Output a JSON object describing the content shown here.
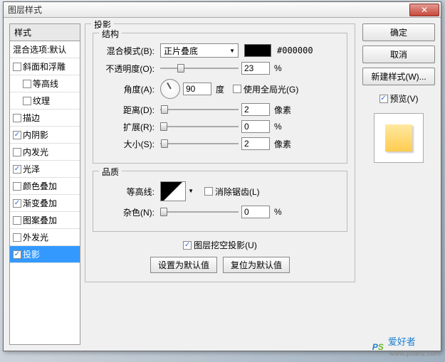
{
  "title": "图层样式",
  "close": "✕",
  "stylesHeader": "样式",
  "blendHeader": "混合选项:默认",
  "effects": [
    {
      "label": "斜面和浮雕",
      "checked": false,
      "sub": false
    },
    {
      "label": "等高线",
      "checked": false,
      "sub": true
    },
    {
      "label": "纹理",
      "checked": false,
      "sub": true
    },
    {
      "label": "描边",
      "checked": false,
      "sub": false
    },
    {
      "label": "内阴影",
      "checked": true,
      "sub": false
    },
    {
      "label": "内发光",
      "checked": false,
      "sub": false
    },
    {
      "label": "光泽",
      "checked": true,
      "sub": false
    },
    {
      "label": "颜色叠加",
      "checked": false,
      "sub": false
    },
    {
      "label": "渐变叠加",
      "checked": true,
      "sub": false
    },
    {
      "label": "图案叠加",
      "checked": false,
      "sub": false
    },
    {
      "label": "外发光",
      "checked": false,
      "sub": false
    },
    {
      "label": "投影",
      "checked": true,
      "sub": false,
      "selected": true
    }
  ],
  "center": {
    "headerGroup": "投影",
    "structGroup": "结构",
    "blendModeLabel": "混合模式(B):",
    "blendModeValue": "正片叠底",
    "hex": "#000000",
    "opacityLabel": "不透明度(O):",
    "opacityValue": "23",
    "percent": "%",
    "angleLabel": "角度(A):",
    "angleValue": "90",
    "degree": "度",
    "globalLight": "使用全局光(G)",
    "distanceLabel": "距离(D):",
    "distanceValue": "2",
    "pixel": "像素",
    "spreadLabel": "扩展(R):",
    "spreadValue": "0",
    "sizeLabel": "大小(S):",
    "sizeValue": "2",
    "qualityGroup": "品质",
    "contourLabel": "等高线:",
    "antialias": "消除锯齿(L)",
    "noiseLabel": "杂色(N):",
    "noiseValue": "0",
    "knockout": "图层挖空投影(U)",
    "setDefault": "设置为默认值",
    "resetDefault": "复位为默认值"
  },
  "right": {
    "ok": "确定",
    "cancel": "取消",
    "newStyle": "新建样式(W)...",
    "preview": "预览(V)"
  },
  "watermark": {
    "text": "爱好者",
    "url": "www.psahz.com"
  }
}
